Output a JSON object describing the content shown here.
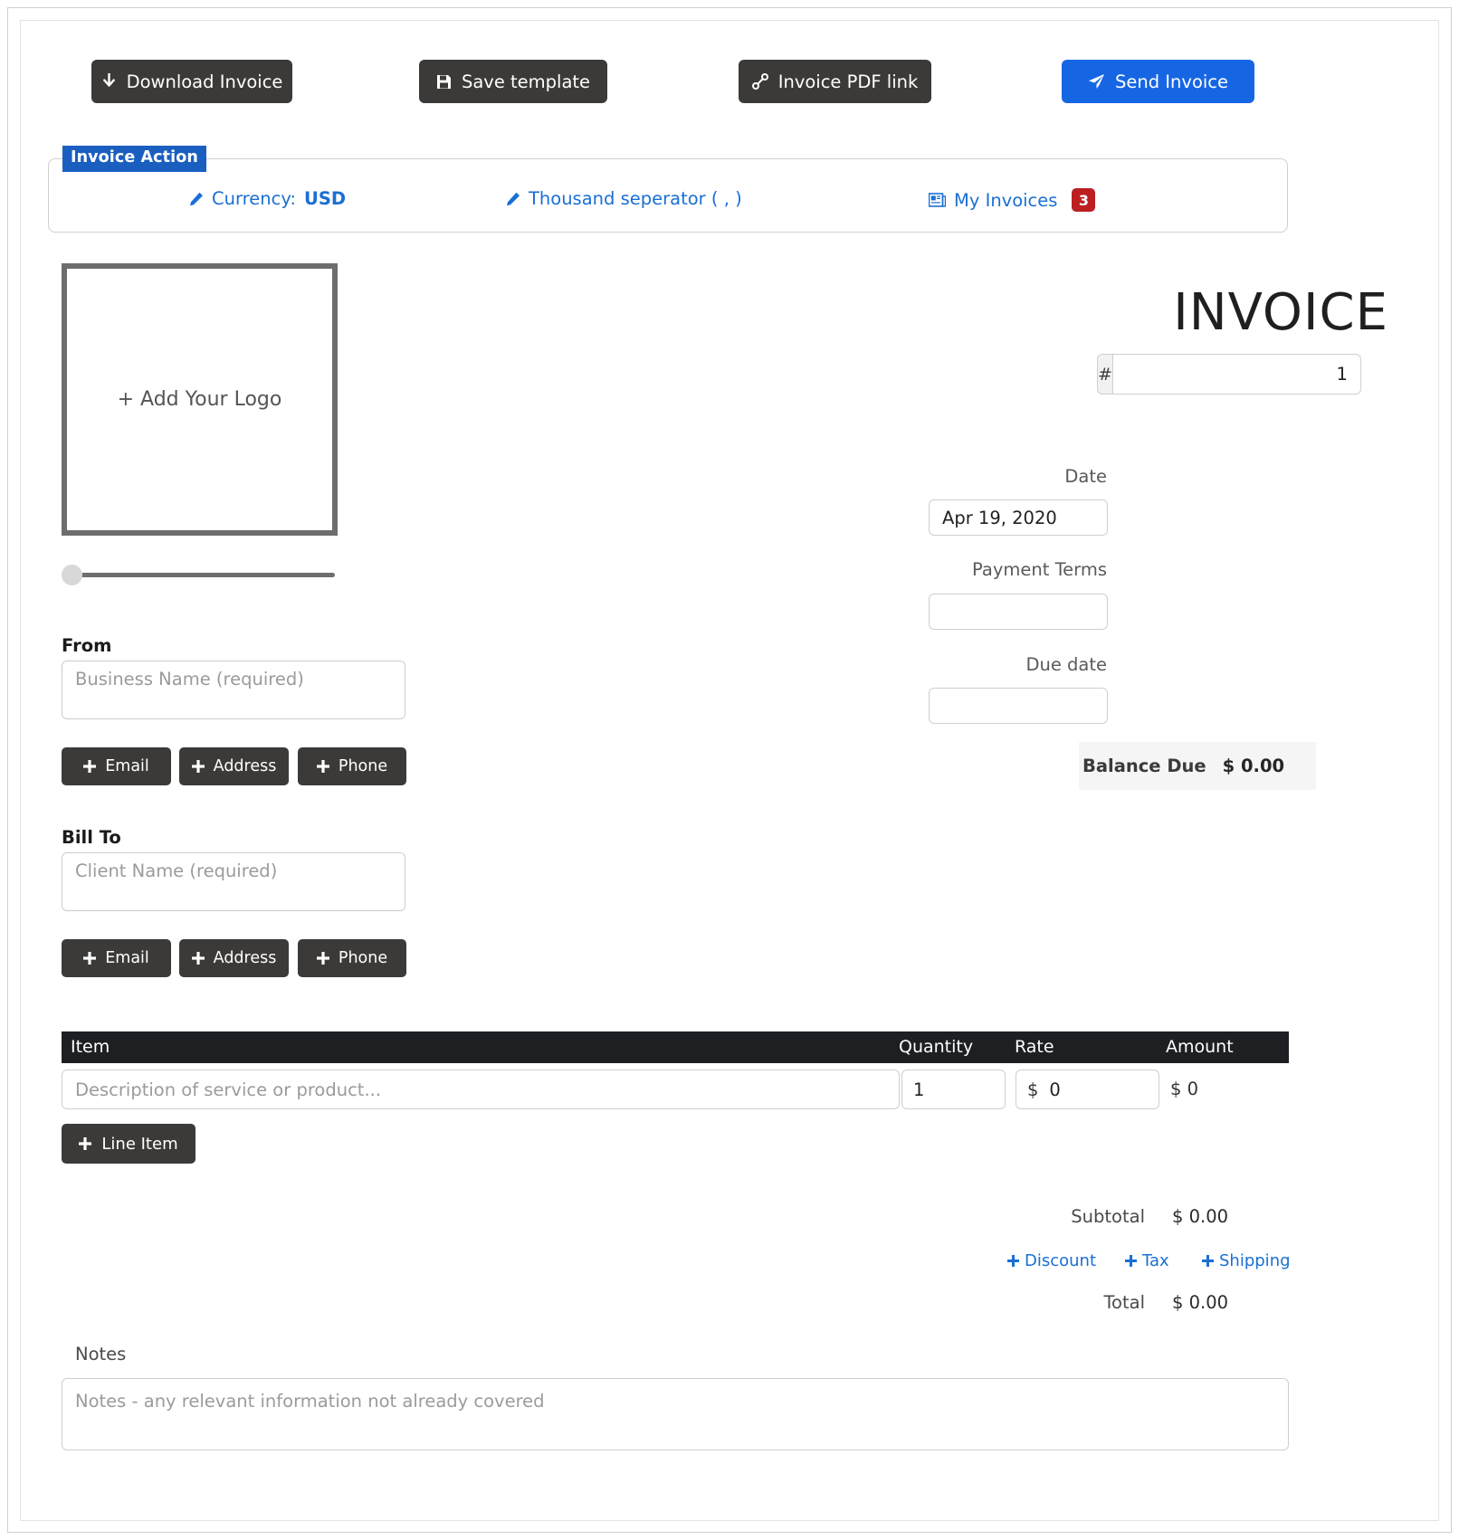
{
  "toolbar": {
    "download_label": "Download Invoice",
    "save_label": "Save template",
    "pdf_label": "Invoice PDF link",
    "send_label": "Send Invoice",
    "primary_color": "#1666e4",
    "dark_color": "#3c3a38"
  },
  "invoice_action": {
    "legend": "Invoice Action",
    "legend_bg": "#1a5fc0",
    "currency_prefix": "Currency:",
    "currency_value": "USD",
    "separator_label": "Thousand seperator ( , )",
    "my_invoices_label": "My Invoices",
    "my_invoices_count": "3",
    "badge_color": "#bb1f22",
    "link_color": "#1a6fd4"
  },
  "logo": {
    "placeholder": "+ Add Your Logo",
    "slider_value": "0"
  },
  "from": {
    "label": "From",
    "placeholder": "Business Name (required)",
    "value": "",
    "buttons": [
      "Email",
      "Address",
      "Phone"
    ]
  },
  "bill_to": {
    "label": "Bill To",
    "placeholder": "Client Name (required)",
    "value": "",
    "buttons": [
      "Email",
      "Address",
      "Phone"
    ]
  },
  "header": {
    "title": "INVOICE",
    "number_prefix": "#",
    "number_value": "1",
    "date_label": "Date",
    "date_value": "Apr 19, 2020",
    "terms_label": "Payment Terms",
    "terms_value": "",
    "due_label": "Due date",
    "due_value": "",
    "balance_label": "Balance Due",
    "balance_value": "$ 0.00"
  },
  "items": {
    "columns": [
      "Item",
      "Quantity",
      "Rate",
      "Amount"
    ],
    "rows": [
      {
        "description": "",
        "description_placeholder": "Description of service or product...",
        "quantity": "1",
        "rate_currency": "$",
        "rate": "0",
        "amount": "$ 0"
      }
    ],
    "add_line_item_label": "Line Item"
  },
  "totals": {
    "subtotal_label": "Subtotal",
    "subtotal_value": "$ 0.00",
    "discount_label": "Discount",
    "tax_label": "Tax",
    "shipping_label": "Shipping",
    "total_label": "Total",
    "total_value": "$ 0.00"
  },
  "notes": {
    "label": "Notes",
    "placeholder": "Notes - any relevant information not already covered",
    "value": ""
  }
}
